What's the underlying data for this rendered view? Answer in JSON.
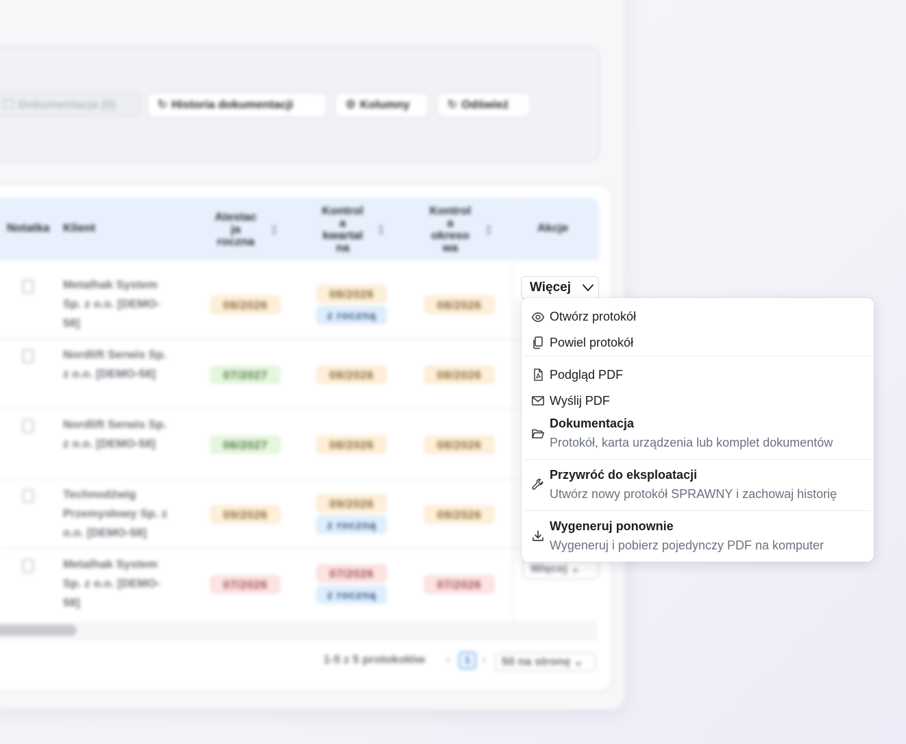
{
  "toolbar": {
    "dokumentacja": "Dokumentacja (0)",
    "historia": "Historia dokumentacji",
    "kolumny": "Kolumny",
    "odswiez": "Odśwież"
  },
  "table": {
    "headers": {
      "notatka": "Notatka",
      "klient": "Klient",
      "atestacja": [
        "Atestac",
        "ja",
        "roczna"
      ],
      "kwartalna": [
        "Kontrol",
        "a",
        "kwartal",
        "na"
      ],
      "okresowa": [
        "Kontrol",
        "a",
        "okreso",
        "wa"
      ],
      "akcje": "Akcje"
    },
    "rows": [
      {
        "client": [
          "Metalhak System",
          "Sp. z o.o. [DEMO-",
          "58]"
        ],
        "atestacja": "08/2026",
        "kwartalna": "08/2026",
        "kwartalna_note": "z roczną",
        "okresowa": "08/2026"
      },
      {
        "client": [
          "Nordlift Serwis Sp.",
          "z o.o. [DEMO-58]"
        ],
        "atestacja": "07/2027",
        "kwartalna": "08/2026",
        "okresowa": "08/2026"
      },
      {
        "client": [
          "Nordlift Serwis Sp.",
          "z o.o. [DEMO-58]"
        ],
        "atestacja": "06/2027",
        "kwartalna": "08/2026",
        "okresowa": "08/2026"
      },
      {
        "client": [
          "Technodźwig",
          "Przemysłowy Sp. z",
          "o.o. [DEMO-58]"
        ],
        "atestacja": "09/2026",
        "kwartalna": "09/2026",
        "kwartalna_note": "z roczną",
        "okresowa": "09/2026"
      },
      {
        "client": [
          "Metalhak System",
          "Sp. z o.o. [DEMO-",
          "58]"
        ],
        "atestacja": "07/2026",
        "kwartalna": "07/2026",
        "kwartalna_note": "z roczną",
        "okresowa": "07/2026"
      }
    ]
  },
  "actions": {
    "more_label": "Więcej",
    "more_label_bg": "Więcej"
  },
  "pager": {
    "summary": "1-5 z 5 protokołów",
    "current_page": "1",
    "per_page": "50 na stronę"
  },
  "menu": {
    "open": "Otwórz protokół",
    "duplicate": "Powiel protokół",
    "preview_pdf": "Podgląd PDF",
    "send_pdf": "Wyślij PDF",
    "docs_title": "Dokumentacja",
    "docs_sub": "Protokół, karta urządzenia lub komplet dokumentów",
    "restore_title": "Przywróć do eksploatacji",
    "restore_sub": "Utwórz nowy protokół SPRAWNY i zachowaj historię",
    "regen_title": "Wygeneruj ponownie",
    "regen_sub": "Wygeneruj i pobierz pojedynczy PDF na komputer"
  },
  "colors": {
    "orange": "#fdefd8",
    "green": "#e6f7df",
    "red": "#fde3e3",
    "blue": "#dfeefd",
    "header": "#e8f0fd"
  }
}
